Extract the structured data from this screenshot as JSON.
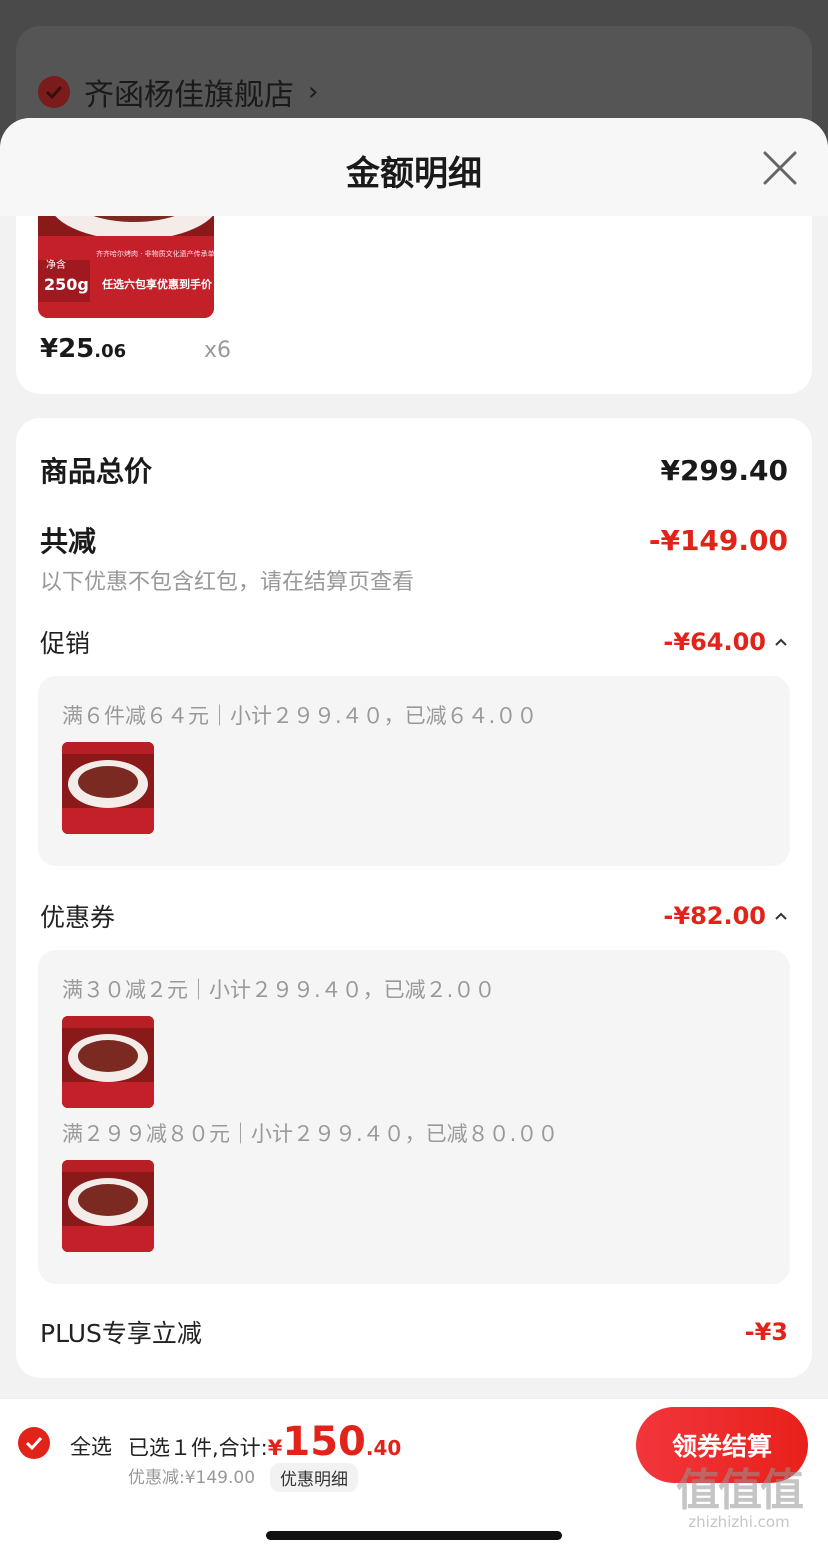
{
  "background": {
    "store_name": "齐函杨佳旗舰店",
    "store_arrow": "›"
  },
  "sheet": {
    "title": "金额明细"
  },
  "product": {
    "image_lines": {
      "weight": "250g",
      "banner": "任选六包享优惠到手价",
      "tagline": "齐齐哈尔烤肉 · 非物质文化遗产传承单位"
    },
    "price_int": "¥25",
    "price_dec": ".06",
    "quantity": "x6"
  },
  "summary": {
    "total_label": "商品总价",
    "total_value": "¥299.40",
    "reduce_label": "共减",
    "reduce_value": "-¥149.00",
    "note": "以下优惠不包含红包，请在结算页查看"
  },
  "promotion": {
    "label": "促销",
    "value": "-¥64.00",
    "lines": [
      "满６件减６４元｜小计２９９.４０，已减６４.００"
    ]
  },
  "coupon": {
    "label": "优惠券",
    "value": "-¥82.00",
    "lines": [
      "满３０减２元｜小计２９９.４０，已减２.００",
      "满２９９减８０元｜小计２９９.４０，已减８０.００"
    ]
  },
  "plus": {
    "label": "PLUS专享立减",
    "value": "-¥3"
  },
  "bottom_bar": {
    "select_all": "全选",
    "selected_text": "已选１件,合计:",
    "total_symbol": "¥",
    "total_int": "150",
    "total_dec": ".40",
    "discount_text": "优惠减:¥149.00",
    "detail_tag": "优惠明细",
    "checkout": "领券结算"
  },
  "watermark": {
    "mark": "值值值",
    "url": "zhizhizhi.com"
  },
  "colors": {
    "accent_red": "#e2231a",
    "gray_text": "#999999"
  },
  "icons": {
    "close": "close-icon",
    "check": "check-icon",
    "caret": "caret-up-icon"
  }
}
